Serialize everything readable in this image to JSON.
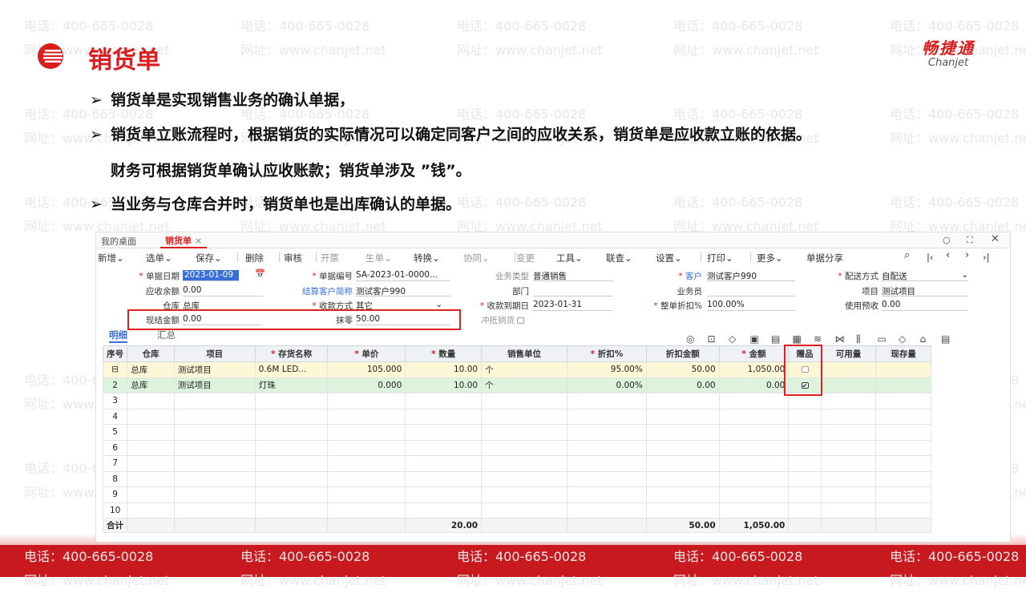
{
  "slide": {
    "title": "销货单",
    "brand_cn": "畅捷通",
    "brand_en": "Chanjet",
    "watermark_phone": "电话：400-665-0028",
    "watermark_site": "网址：www.chanjet.net",
    "bullets": [
      "销货单是实现销售业务的确认单据，",
      "销货单立账流程时，根据销货的实际情况可以确定同客户之间的应收关系，销货单是应收款立账的依据。",
      "财务可根据销货单确认应收账款；销货单涉及 ”钱”。",
      "当业务与仓库合并时，销货单也是出库确认的单据。"
    ],
    "accent": "#d81e1e"
  },
  "app": {
    "tabs": [
      "我的桌面",
      "销货单"
    ],
    "toolbar": [
      "新增⌄",
      "选单⌄",
      "保存⌄",
      "删除",
      "审核",
      "开票",
      "生单⌄",
      "转换⌄",
      "协同⌄",
      "变更",
      "工具⌄",
      "联查⌄",
      "设置⌄",
      "打印⌄",
      "更多⌄",
      "单据分享"
    ],
    "fields": {
      "date_lbl": "单据日期",
      "date_val": "2023-01-09",
      "no_lbl": "单据编号",
      "no_val": "SA-2023-01-0000...",
      "biztype_lbl": "业务类型",
      "biztype_val": "普通销售",
      "cust_lbl": "客户",
      "cust_val": "测试客户990",
      "ship_lbl": "配送方式",
      "ship_val": "自配送",
      "ar_lbl": "应收余额",
      "ar_val": "0.00",
      "settle_lbl": "结算客户简称",
      "settle_val": "测试客户990",
      "dept_lbl": "部门",
      "sales_lbl": "业务员",
      "proj_lbl": "项目",
      "proj_val": "测试项目",
      "wh_lbl": "仓库",
      "wh_val": "总库",
      "pay_lbl": "收款方式",
      "pay_val": "其它",
      "due_lbl": "收款到期日",
      "due_val": "2023-01-31",
      "disc_lbl": "整单折扣%",
      "disc_val": "100.00%",
      "prepay_lbl": "使用预收",
      "prepay_val": "0.00",
      "cash_lbl": "现结金额",
      "cash_val": "0.00",
      "round_lbl": "抹零",
      "round_val": "50.00",
      "offset_lbl": "冲抵销货"
    },
    "subtabs": [
      "明细",
      "汇总"
    ],
    "columns": [
      "序号",
      "仓库",
      "项目",
      "存货名称",
      "单价",
      "数量",
      "销售单位",
      "折扣%",
      "折扣金额",
      "金额",
      "赠品",
      "可用量",
      "现存量"
    ],
    "rows": [
      {
        "no": "",
        "wh": "总库",
        "proj": "测试项目",
        "name": "0.6M LED...",
        "price": "105.000",
        "qty": "10.00",
        "unit": "个",
        "disc": "95.00%",
        "discamt": "50.00",
        "amt": "1,050.00",
        "gift": false
      },
      {
        "no": "2",
        "wh": "总库",
        "proj": "测试项目",
        "name": "灯珠",
        "price": "0.000",
        "qty": "10.00",
        "unit": "个",
        "disc": "0.00%",
        "discamt": "0.00",
        "amt": "0.00",
        "gift": true
      }
    ],
    "empty_rows": [
      "3",
      "4",
      "5",
      "6",
      "7",
      "8",
      "9",
      "10"
    ],
    "total": {
      "label": "合计",
      "qty": "20.00",
      "discamt": "50.00",
      "amt": "1,050.00"
    }
  }
}
